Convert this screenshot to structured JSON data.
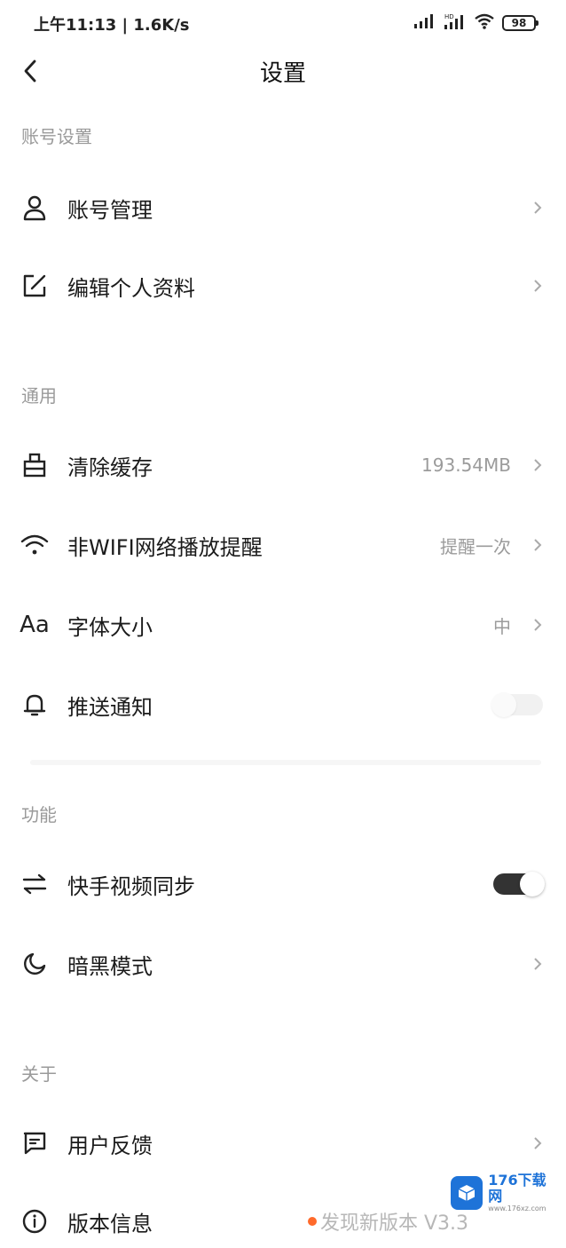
{
  "status_bar": {
    "time_speed": "上午11:13 | 1.6K/s",
    "battery": "98"
  },
  "header": {
    "title": "设置"
  },
  "sections": {
    "account": {
      "title": "账号设置",
      "items": [
        {
          "label": "账号管理",
          "icon": "user-icon"
        },
        {
          "label": "编辑个人资料",
          "icon": "edit-icon"
        }
      ]
    },
    "general": {
      "title": "通用",
      "items": [
        {
          "label": "清除缓存",
          "value": "193.54MB",
          "icon": "broom-icon"
        },
        {
          "label": "非WIFI网络播放提醒",
          "value": "提醒一次",
          "icon": "wifi-icon"
        },
        {
          "label": "字体大小",
          "value": "中",
          "icon": "font-size-icon"
        },
        {
          "label": "推送通知",
          "toggle": false,
          "icon": "bell-icon"
        }
      ]
    },
    "features": {
      "title": "功能",
      "items": [
        {
          "label": "快手视频同步",
          "toggle": true,
          "icon": "sync-arrows-icon"
        },
        {
          "label": "暗黑模式",
          "icon": "moon-icon"
        }
      ]
    },
    "about": {
      "title": "关于",
      "items": [
        {
          "label": "用户反馈",
          "icon": "feedback-icon"
        },
        {
          "label": "版本信息",
          "value": "发现新版本 V3.3",
          "icon": "info-icon"
        }
      ]
    }
  },
  "font_icon_text": "Aa",
  "watermark": {
    "main": "176下载网",
    "sub": "www.176xz.com"
  },
  "colors": {
    "accent_dot": "#ff6a2b",
    "toggle_on": "#333333",
    "secondary_text": "#9a9a9a"
  }
}
